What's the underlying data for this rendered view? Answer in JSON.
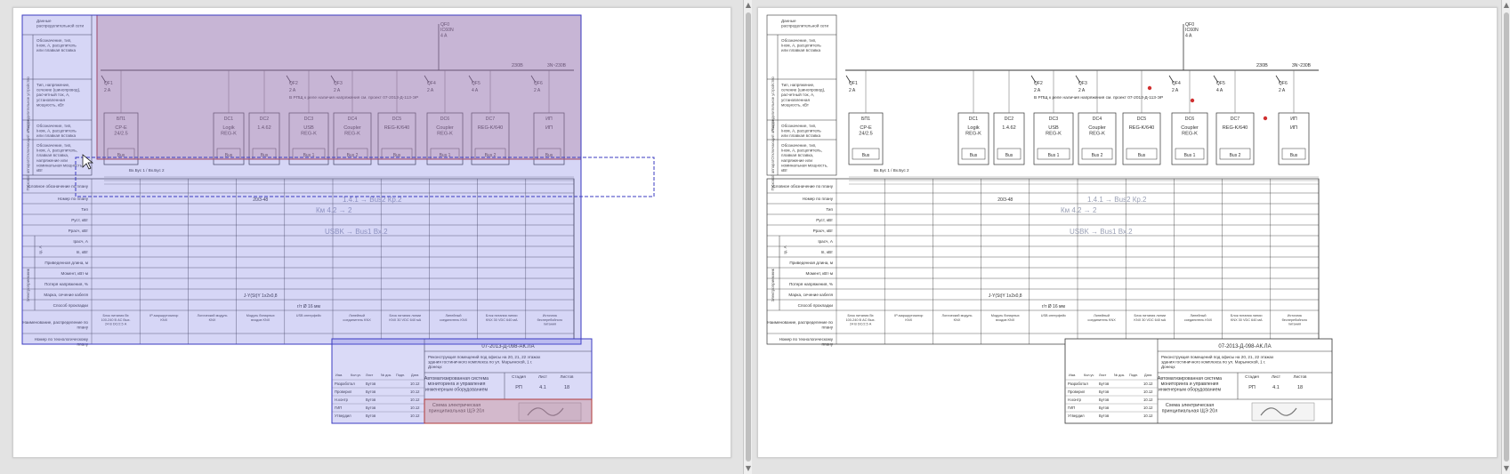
{
  "drawing": {
    "left_header_labels": [
      "Данные распределительной сети",
      "Обозначение, тип, Iном, А, расцепитель или плавкая вставка",
      "Тип, напряжение, сечение (шинопровод), расчетный ток, А, установленная мощность, кВт",
      "Обозначение, тип, Iном, А, расцепитель или плавкая вставка",
      "Обозначение, тип, Iном, А, расцепитель, плавкая вставка, напряжение или номинальная мощность, кВт"
    ],
    "side_labels": [
      "Распределительное устройство",
      "Отключающий аппарат",
      "Пусковой аппарат"
    ],
    "breakers": [
      "QF1",
      "QF2",
      "QF3",
      "QF4",
      "QF5",
      "QF6"
    ],
    "breaker_ratings": [
      "2 A",
      "2 A",
      "2 A",
      "2 A",
      "4 A",
      "2 A"
    ],
    "main_breaker": "QF0\nIC60N\n4 A",
    "bus_rating": "230B",
    "bus_rating_right": "3N~230B",
    "rpd_note": "В РПЩ к реле наличия напряжения см. проект 07-2013-Д-113-ЭР",
    "devices": [
      {
        "id": "БП1",
        "type": "CP-E 24/2.5"
      },
      {
        "id": "DC1",
        "type": "Logik REG-K"
      },
      {
        "id": "DC2",
        "type": "1.4.62"
      },
      {
        "id": "DC3",
        "type": "USB REG-K"
      },
      {
        "id": "DC4",
        "type": "Coupler REG-K"
      },
      {
        "id": "DC5",
        "type": "REG-K/640"
      },
      {
        "id": "DC6",
        "type": "Coupler REG-K"
      },
      {
        "id": "DC7",
        "type": "REG-K/640"
      },
      {
        "id": "ИП",
        "type": "ИП"
      }
    ],
    "bus_labels": [
      "Bus",
      "Bus",
      "Bus",
      "Bus 1",
      "Bus 2",
      "Bus",
      "Bus 1",
      "Bus 2",
      "Bus"
    ],
    "bus_note": "Вх.Бус 1 / Вх.Бус 2",
    "table_rows": [
      "Условное обозначение по плану",
      "Номер по плану",
      "Тип",
      "Руст, кВт",
      "Ррасч, кВт",
      "Iрасч, А",
      "Iп, кВт",
      "Приведенная длина, м",
      "Момент, кВт·м",
      "Потеря напряжения, %",
      "Марка, сечение кабеля",
      "Способ прокладки",
      "Наименование, распределение по плану",
      "Номер по технологическому плану"
    ],
    "table_group_labels": [
      "Электроприемник",
      "Iр, А"
    ],
    "plan_number": "20/3-48",
    "cable": "J-Y(St)Y 1x2x0,8",
    "laying": "г/т Ø 16 мм",
    "consumer_names": [
      "Блок питания Вх 100-240 В АС Вых. 24 В DC/2.5 А",
      "IP-маршрутизатор KNX",
      "Логический модуль KNX",
      "Модуль бинарных входов KNX",
      "USB интерфейс",
      "Линейный соединитель KNX",
      "Блок питания линии KNX 30 VDC 640 мА",
      "Линейный соединитель KNX",
      "Блок питания линии KNX 30 VDC 640 мА",
      "Источник бесперебойного питания"
    ],
    "handwritten": [
      "1.4.1 → Bus2 Кр.2",
      "Км 4.2 → 2",
      "USBK → Bus1 Вх.2"
    ],
    "title_block": {
      "doc_code": "07-2013-Д-098-АК.ЛА",
      "project": "Реконструкция помещений под офисы на 20, 21, 22 этажах здания гостиничного комплекса по ул. Марьинской, 1 г. Донецк",
      "system": "Автоматизированная система мониторинга и управления инженерным оборудованием",
      "sheet_title": "Схема электрическая принципиальная ЩЭ 20л",
      "stage_label": "Стадия",
      "sheet_label": "Лист",
      "sheets_label": "Листов",
      "stage": "РП",
      "sheet": "4.1",
      "sheets": "18",
      "col_labels": [
        "Изм.",
        "Кол.уч",
        "Лист",
        "№ док.",
        "Подп.",
        "Дата"
      ],
      "roles": [
        "Разработал",
        "Проверил",
        "Н.контр",
        "ГИП",
        "Утвердил"
      ],
      "names": [
        "Бутов",
        "Бутов",
        "Бутов",
        "Бутов",
        "Бутов"
      ],
      "dates": [
        "10.12",
        "10.12",
        "10.12",
        "10.12",
        "10.12"
      ]
    }
  }
}
